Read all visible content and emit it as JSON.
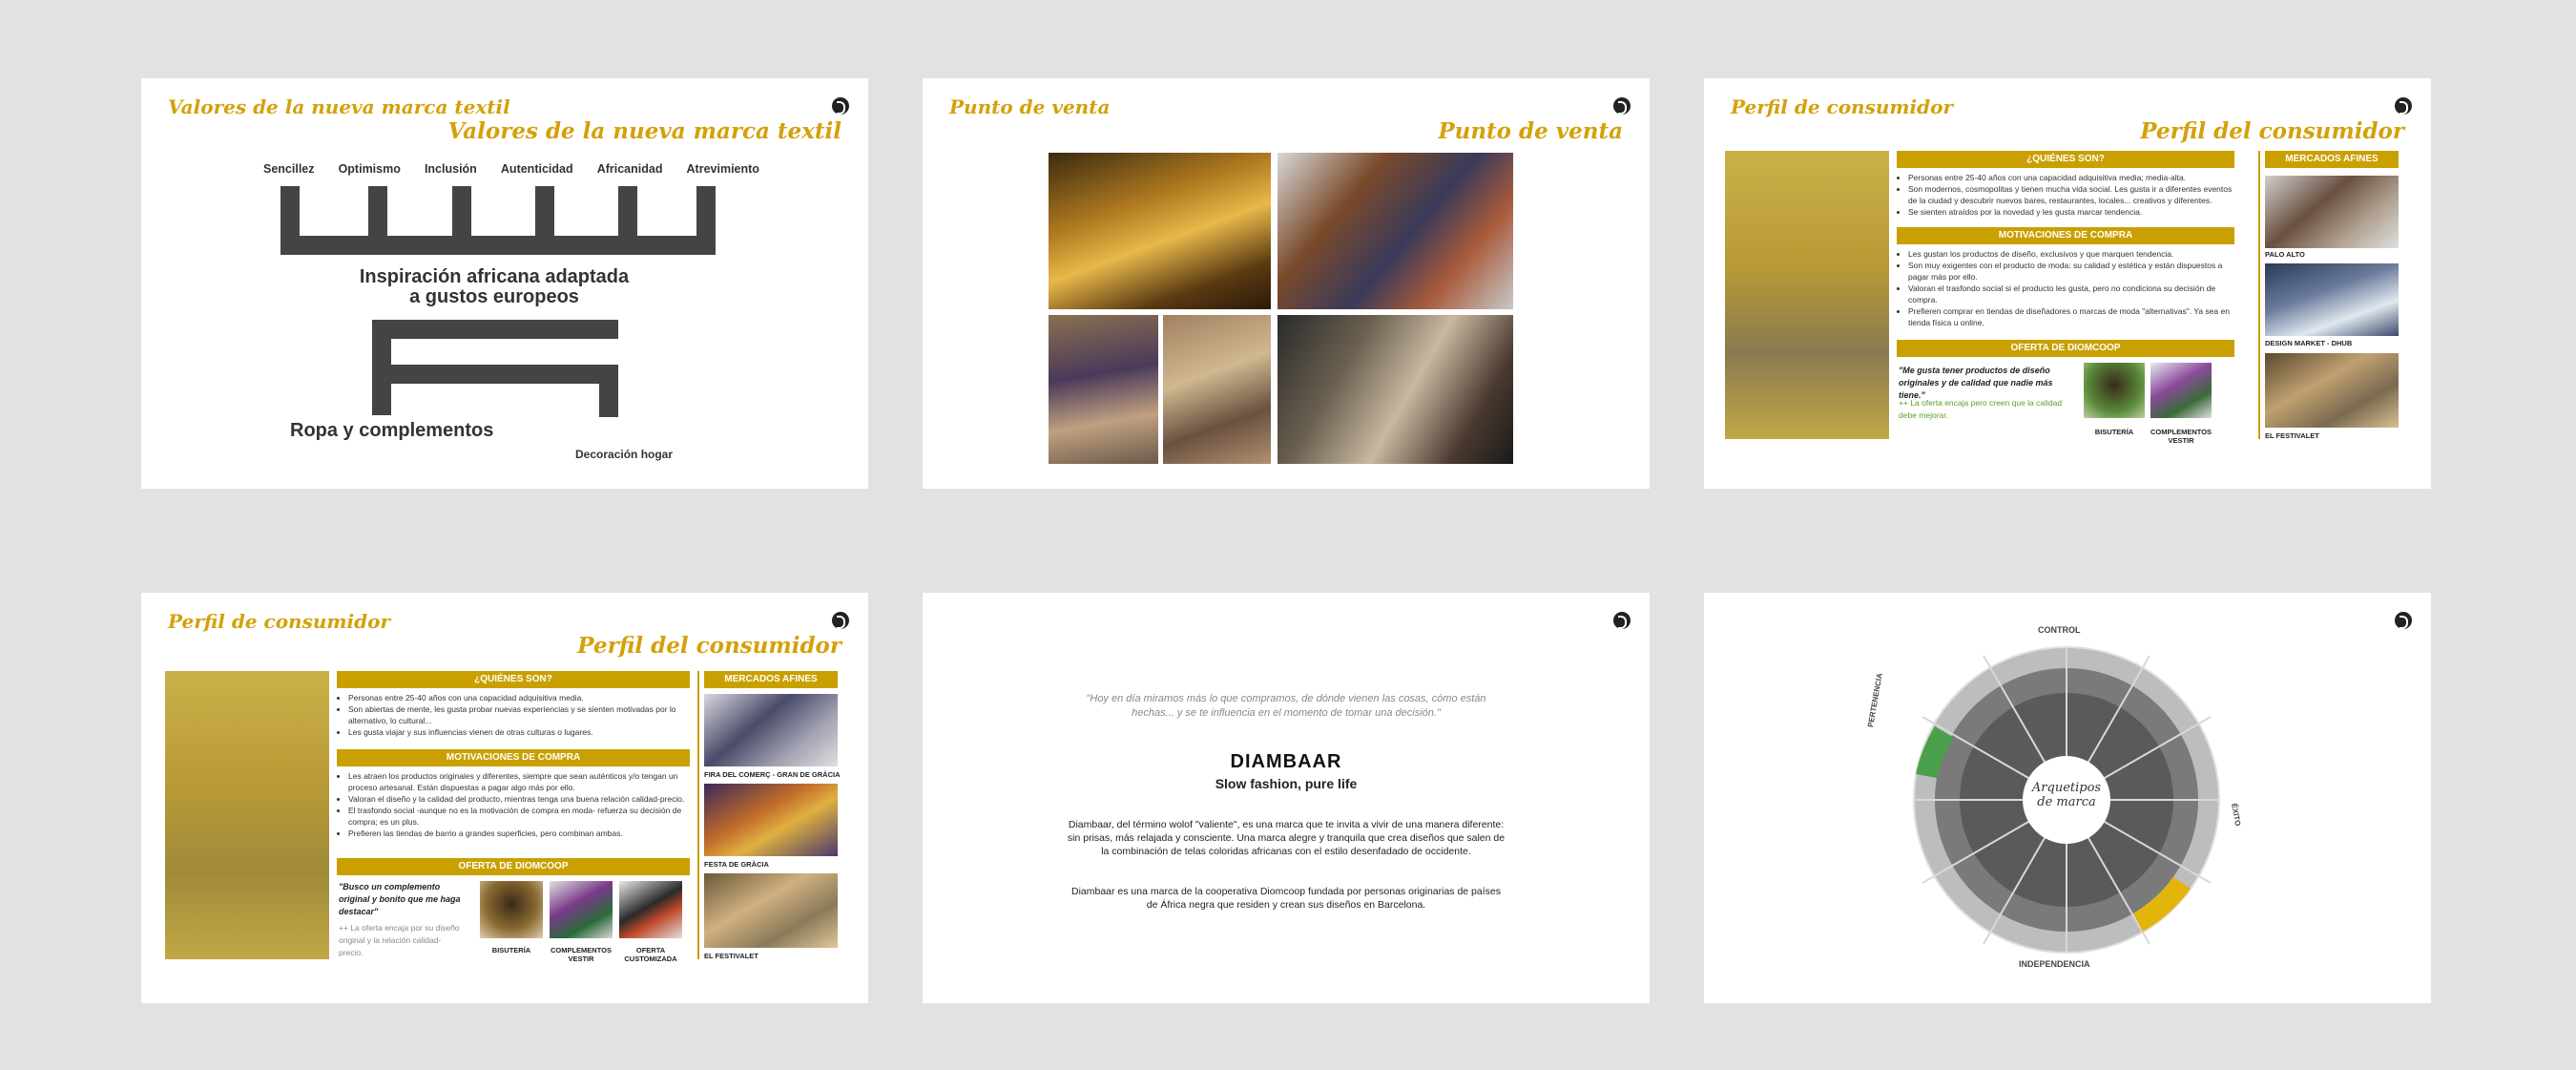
{
  "slides": {
    "s1": {
      "title_small": "Valores de la nueva marca textil",
      "title_large": "Valores de la nueva marca textil",
      "values": [
        "Sencillez",
        "Optimismo",
        "Inclusión",
        "Autenticidad",
        "Africanidad",
        "Atrevimiento"
      ],
      "center_line1": "Inspiración africana adaptada",
      "center_line2": "a gustos europeos",
      "left_label": "Ropa y complementos",
      "right_label": "Decoración hogar"
    },
    "s2": {
      "title_small": "Punto de venta",
      "title_large": "Punto de venta"
    },
    "s3": {
      "title_small": "Perfil de consumidor",
      "title_large": "Perfil del consumidor",
      "quienes": "¿QUIÉNES SON?",
      "quienes_items": [
        "Personas entre 25-40 años con una capacidad adquisitiva media; media-alta.",
        "Son modernos, cosmopolitas y tienen mucha vida social. Les gusta ir a diferentes eventos de la ciudad y descubrir nuevos bares, restaurantes, locales... creativos y diferentes.",
        "Se sienten atraídos por la novedad y les gusta marcar tendencia."
      ],
      "motivaciones": "MOTIVACIONES DE COMPRA",
      "motivaciones_items": [
        "Les gustan los productos de diseño, exclusivos y que marquen tendencia.",
        "Son muy exigentes con el producto de moda: su calidad y estética y están dispuestos a pagar más por ello.",
        "Valoran el trasfondo social si el producto les gusta, pero no condiciona su decisión de compra.",
        "Prefieren comprar en tiendas de diseñadores o marcas de moda \"alternativas\". Ya sea en tienda física u online."
      ],
      "oferta": "OFERTA DE DIOMCOOP",
      "quote": "\"Me gusta tener productos de diseño originales y de calidad que nadie más tiene.\"",
      "note": "++ La oferta encaja pero creen que la calidad debe mejorar.",
      "products": [
        "BISUTERÍA",
        "COMPLEMENTOS VESTIR"
      ],
      "mercados": "MERCADOS AFINES",
      "mercados_items": [
        "PALO ALTO",
        "DESIGN MARKET - DHUB",
        "EL FESTIVALET"
      ]
    },
    "s4": {
      "title_small": "Perfil de consumidor",
      "title_large": "Perfil del consumidor",
      "quienes": "¿QUIÉNES SON?",
      "quienes_items": [
        "Personas entre 25-40 años con una capacidad adquisitiva media.",
        "Son abiertas de mente, les gusta probar nuevas experiencias y se sienten motivadas por lo alternativo, lo cultural...",
        "Les gusta viajar y sus influencias vienen de otras culturas o lugares."
      ],
      "motivaciones": "MOTIVACIONES DE COMPRA",
      "motivaciones_items": [
        "Les atraen los productos originales y diferentes, siempre que sean auténticos y/o tengan un proceso artesanal. Están dispuestas a pagar algo más por ello.",
        "Valoran el diseño y la calidad del producto, mientras tenga una buena relación calidad-precio.",
        "El trasfondo social -aunque no es la motivación de compra en moda- refuerza su decisión de compra; es un plus.",
        "Prefieren las tiendas de barrio a grandes superficies, pero combinan ambas."
      ],
      "oferta": "OFERTA DE DIOMCOOP",
      "quote": "\"Busco un complemento original y bonito que me haga destacar\"",
      "note": "++ La oferta encaja por su diseño original y la relación calidad-precio.",
      "products": [
        "BISUTERÍA",
        "COMPLEMENTOS VESTIR",
        "OFERTA CUSTOMIZADA"
      ],
      "mercados": "MERCADOS AFINES",
      "mercados_items": [
        "FIRA DEL COMERÇ - GRAN DE GRÀCIA",
        "FESTA DE GRÀCIA",
        "EL FESTIVALET"
      ]
    },
    "s5": {
      "quote": "\"Hoy en día miramos más lo que compramos, de dónde vienen las cosas, cómo están hechas... y se te influencia en el momento de tomar una decisión.\"",
      "brand": "DIAMBAAR",
      "tagline": "Slow fashion, pure life",
      "para1": "Diambaar, del término wolof \"valiente\", es una marca que te invita a vivir de una manera diferente: sin prisas, más relajada y consciente. Una marca alegre y tranquila que crea diseños que salen de la combinación de telas coloridas africanas con el estilo desenfadado de occidente.",
      "para2": "Diambaar es una marca de la cooperativa Diomcoop fundada por personas originarias de países de África negra que residen y crean sus diseños en Barcelona."
    },
    "s6": {
      "center_title": "Arquetipos de marca",
      "top_label": "CONTROL",
      "left_label": "PERTENENCIA",
      "right_label": "ÉXITO",
      "bottom_label": "INDEPENDENCIA"
    }
  },
  "colors": {
    "accent": "#d4a10a",
    "accent_box": "#c9a000",
    "green": "#5aa02c",
    "background": "#e2e2e2"
  }
}
